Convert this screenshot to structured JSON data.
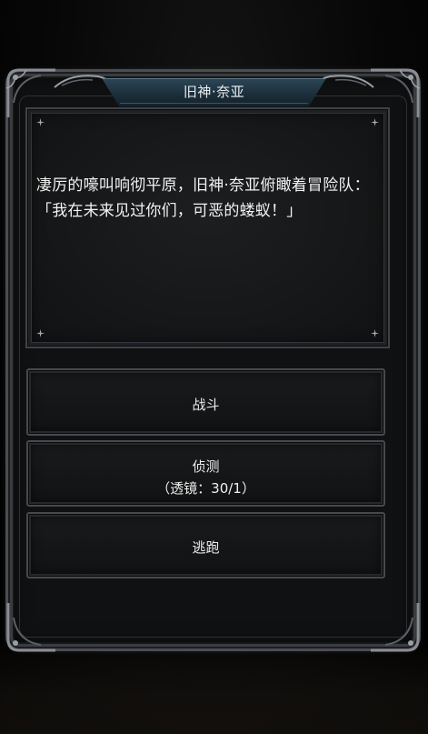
{
  "event": {
    "title": "旧神·奈亚",
    "description": "凄厉的嚎叫响彻平原，旧神·奈亚俯瞰着冒险队：「我在未来见过你们，可恶的蝼蚁！」"
  },
  "options": {
    "fight_label": "战斗",
    "scout_label": "侦测",
    "scout_cost": "（透镜：30/1）",
    "flee_label": "逃跑"
  },
  "colors": {
    "background": "#000000",
    "panel": "#161718",
    "frame": "#4a4d52",
    "banner": "#1c2f3c",
    "text": "#f2f2f2"
  },
  "icons": [
    "corner-ornament-icon",
    "sparkle-icon",
    "banner-wing-icon"
  ]
}
